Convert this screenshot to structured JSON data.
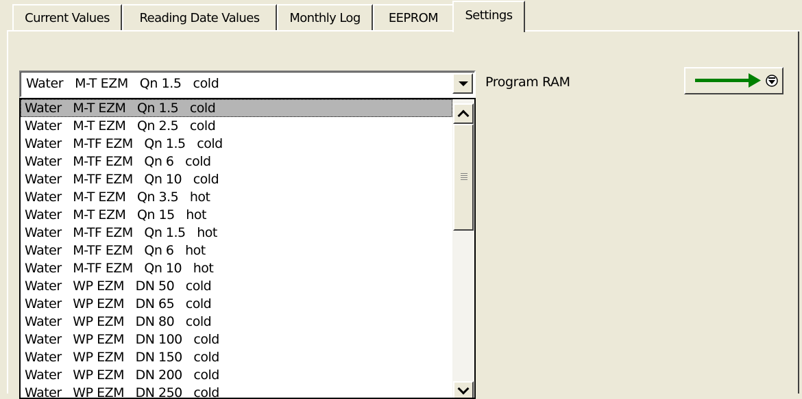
{
  "tabs": [
    {
      "label": "Current Values",
      "active": false
    },
    {
      "label": "Reading Date Values",
      "active": false
    },
    {
      "label": "Monthly Log",
      "active": false
    },
    {
      "label": "EEPROM",
      "active": false
    },
    {
      "label": "Settings",
      "active": true
    }
  ],
  "meter_select": {
    "selected_value": "Water   M-T EZM   Qn 1.5   cold",
    "options": [
      "Water   M-T EZM   Qn 1.5   cold",
      "Water   M-T EZM   Qn 2.5   cold",
      "Water   M-TF EZM   Qn 1.5   cold",
      "Water   M-TF EZM   Qn 6   cold",
      "Water   M-TF EZM   Qn 10   cold",
      "Water   M-T EZM   Qn 3.5   hot",
      "Water   M-T EZM   Qn 15   hot",
      "Water   M-TF EZM   Qn 1.5   hot",
      "Water   M-TF EZM   Qn 6   hot",
      "Water   M-TF EZM   Qn 10   hot",
      "Water   WP EZM   DN 50   cold",
      "Water   WP EZM   DN 65   cold",
      "Water   WP EZM   DN 80   cold",
      "Water   WP EZM   DN 100   cold",
      "Water   WP EZM   DN 150   cold",
      "Water   WP EZM   DN 200   cold",
      "Water   WP EZM   DN 250   cold"
    ],
    "selected_index": 0,
    "scroll_position": 0
  },
  "program": {
    "label": "Program RAM",
    "button_icon": "green-arrow-right-icon",
    "arrow_color": "#008000"
  },
  "colors": {
    "background": "#ece9d8",
    "selection": "#b5b5b5"
  }
}
